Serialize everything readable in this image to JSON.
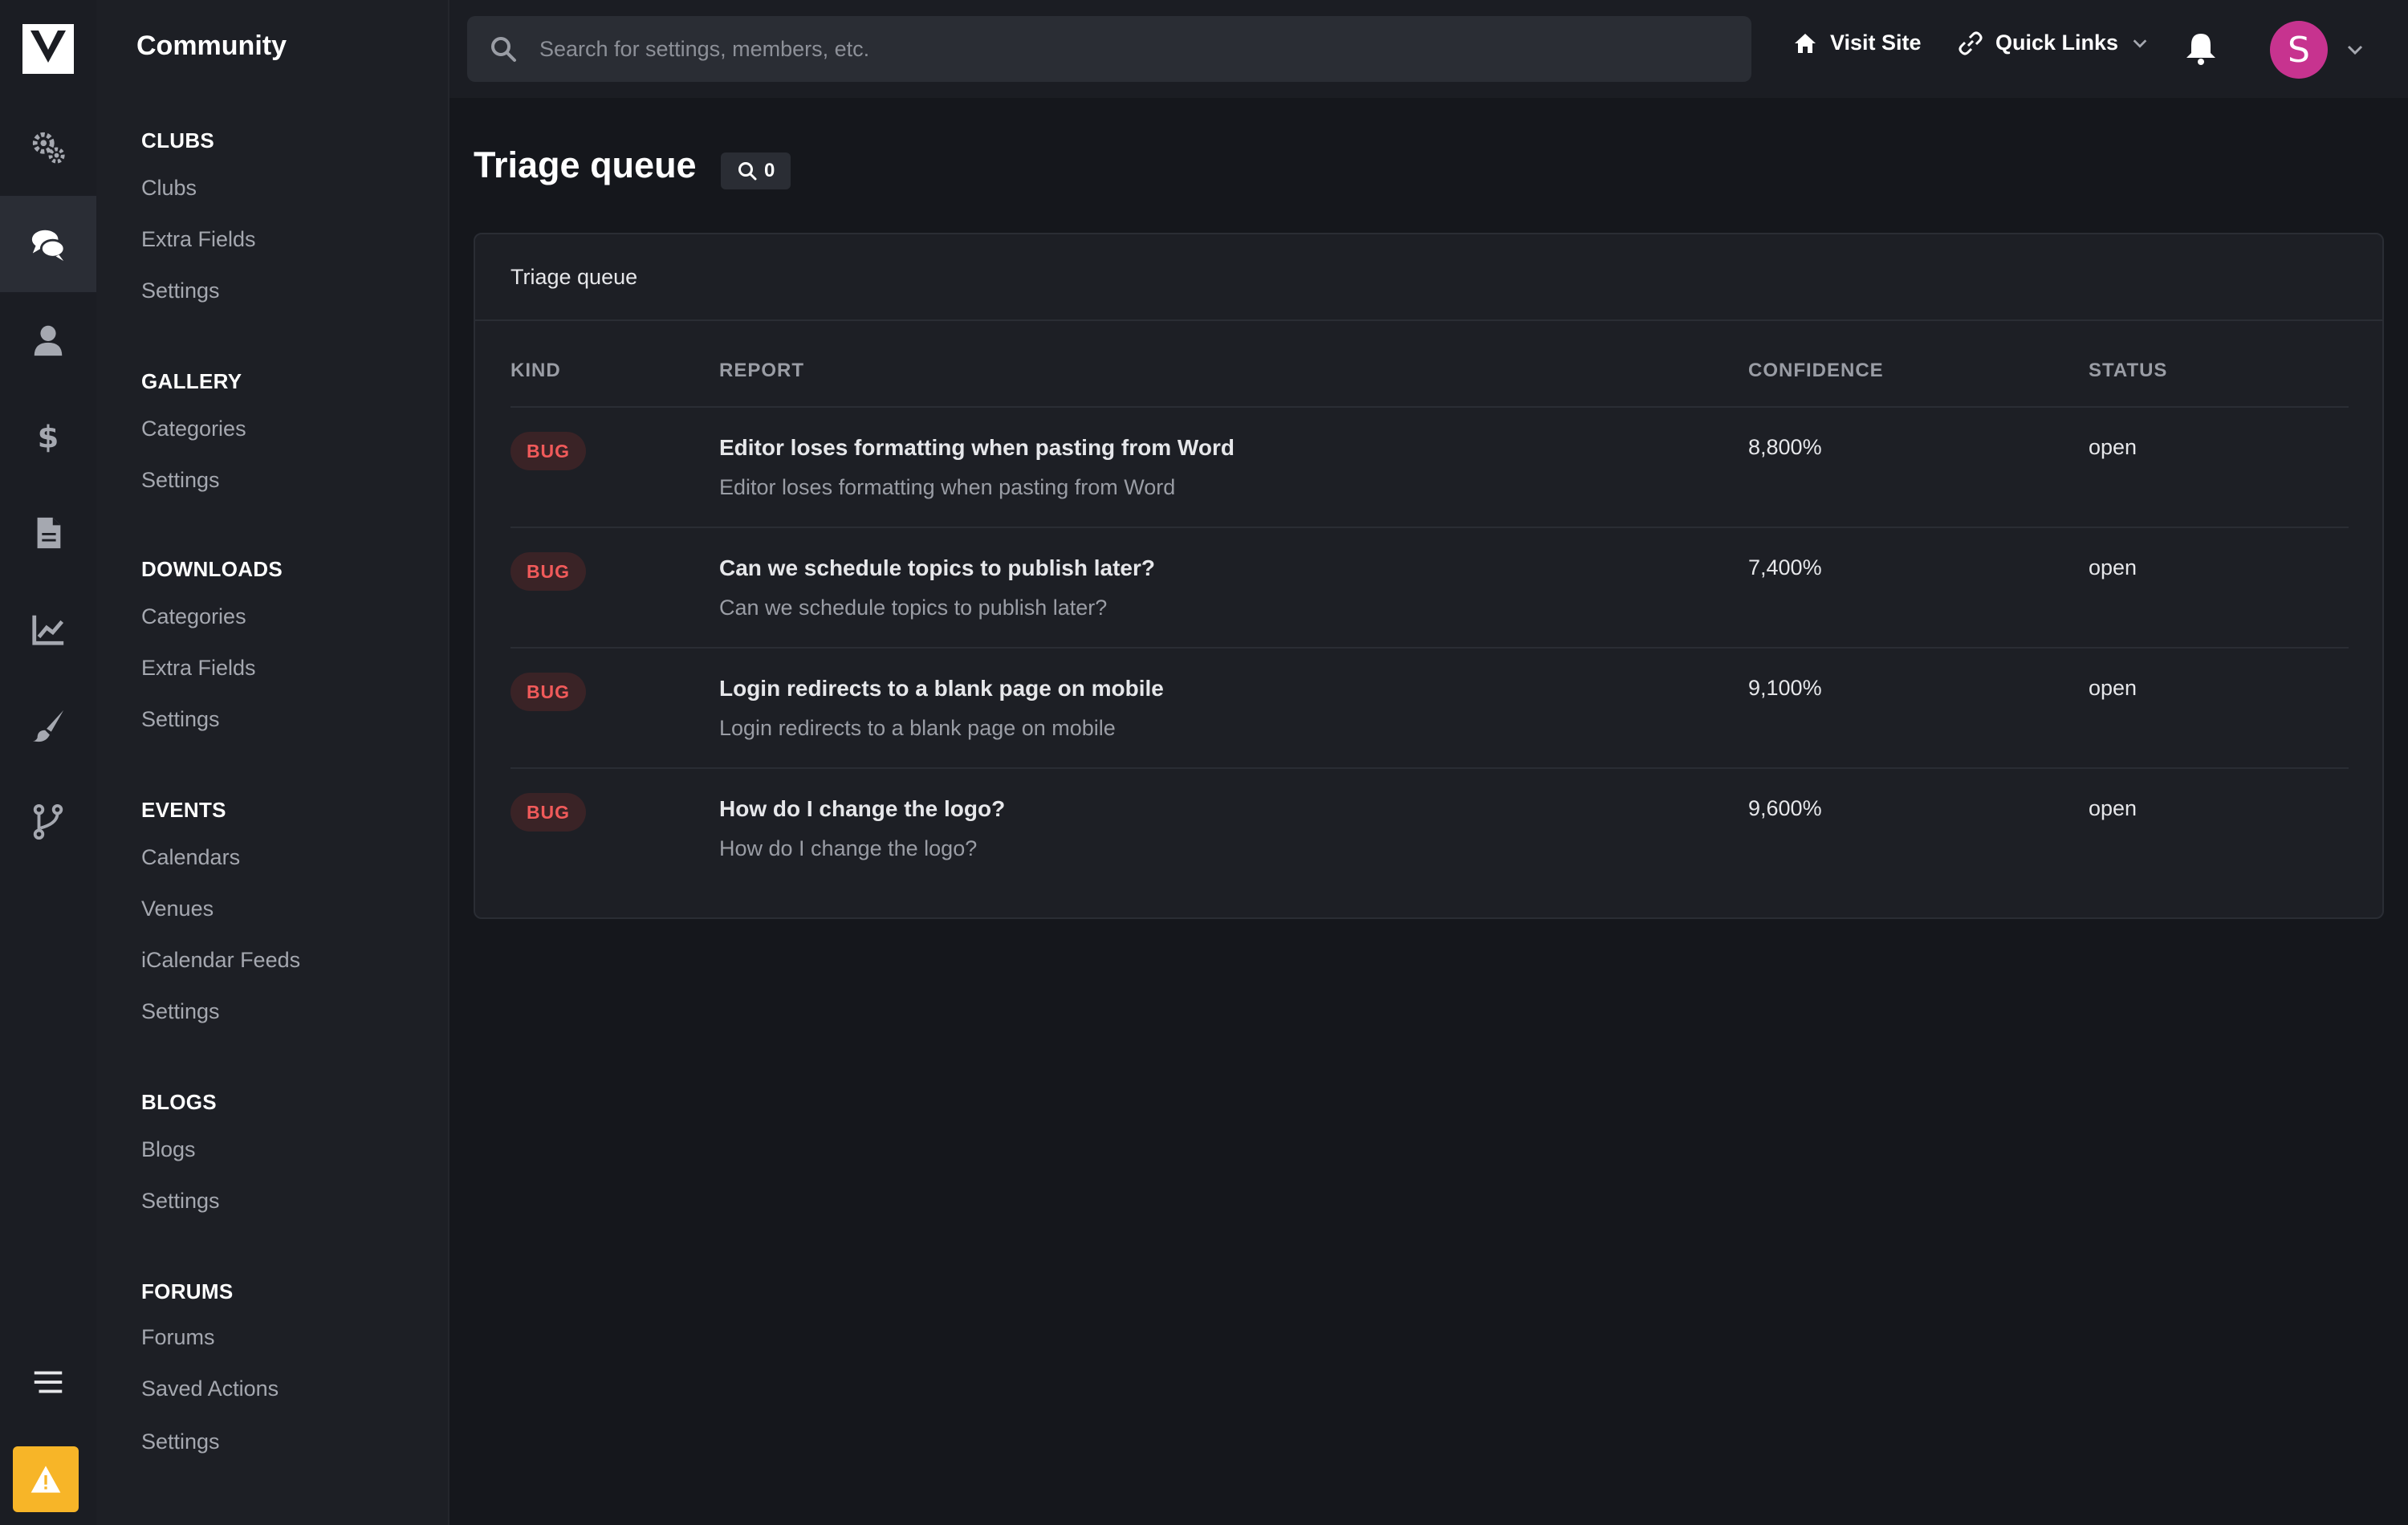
{
  "app": {
    "name": "Community"
  },
  "rail": {
    "icons": [
      "logo-icon",
      "settings-gears-icon",
      "community-chat-icon",
      "members-user-icon",
      "commerce-dollar-icon",
      "pages-document-icon",
      "analytics-chart-icon",
      "customization-brush-icon",
      "system-fork-icon",
      "menu-toggle-icon",
      "warning-icon"
    ]
  },
  "subnav": {
    "sections": [
      {
        "title": "CLUBS",
        "items": [
          "Clubs",
          "Extra Fields",
          "Settings"
        ]
      },
      {
        "title": "GALLERY",
        "items": [
          "Categories",
          "Settings"
        ]
      },
      {
        "title": "DOWNLOADS",
        "items": [
          "Categories",
          "Extra Fields",
          "Settings"
        ]
      },
      {
        "title": "EVENTS",
        "items": [
          "Calendars",
          "Venues",
          "iCalendar Feeds",
          "Settings"
        ]
      },
      {
        "title": "BLOGS",
        "items": [
          "Blogs",
          "Settings"
        ]
      },
      {
        "title": "FORUMS",
        "items": [
          "Forums",
          "Saved Actions",
          "Settings"
        ]
      }
    ]
  },
  "topbar": {
    "search_placeholder": "Search for settings, members, etc.",
    "visit_site": "Visit Site",
    "quick_links": "Quick Links",
    "avatar_initial": "S"
  },
  "page": {
    "title": "Triage queue",
    "count": "0"
  },
  "panel": {
    "title": "Triage queue",
    "columns": {
      "kind": "KIND",
      "report": "REPORT",
      "confidence": "CONFIDENCE",
      "status": "STATUS"
    },
    "rows": [
      {
        "kind": "BUG",
        "title": "Editor loses formatting when pasting from Word",
        "subtitle": "Editor loses formatting when pasting from Word",
        "confidence": "8,800%",
        "status": "open"
      },
      {
        "kind": "BUG",
        "title": "Can we schedule topics to publish later?",
        "subtitle": "Can we schedule topics to publish later?",
        "confidence": "7,400%",
        "status": "open"
      },
      {
        "kind": "BUG",
        "title": "Login redirects to a blank page on mobile",
        "subtitle": "Login redirects to a blank page on mobile",
        "confidence": "9,100%",
        "status": "open"
      },
      {
        "kind": "BUG",
        "title": "How do I change the logo?",
        "subtitle": "How do I change the logo?",
        "confidence": "9,600%",
        "status": "open"
      }
    ]
  },
  "colors": {
    "accent_warning": "#f7b528",
    "bug_badge": "#f05a5a",
    "avatar": "#c7338f"
  }
}
